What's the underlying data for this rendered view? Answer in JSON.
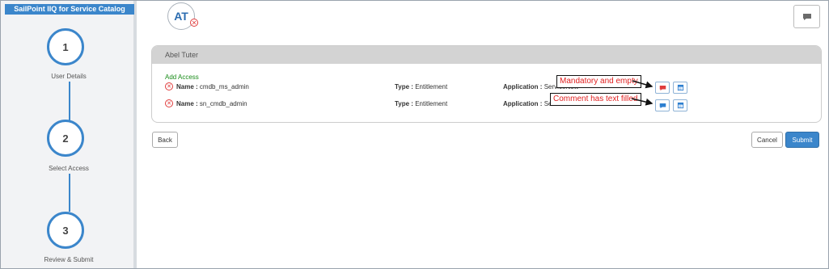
{
  "sidebar": {
    "header": "SailPoint IIQ for Service Catalog",
    "steps": [
      {
        "number": "1",
        "label": "User Details"
      },
      {
        "number": "2",
        "label": "Select Access"
      },
      {
        "number": "3",
        "label": "Review & Submit"
      }
    ]
  },
  "header": {
    "avatar_initials": "AT",
    "avatar_status_icon": "x-circle-icon",
    "comment_icon": "comment-icon"
  },
  "card": {
    "user_name": "Abel Tuter",
    "section_label": "Add Access",
    "rows": [
      {
        "name_label": "Name :",
        "name_value": "cmdb_ms_admin",
        "type_label": "Type :",
        "type_value": "Entitlement",
        "app_label": "Application :",
        "app_value": "ServiceNow"
      },
      {
        "name_label": "Name :",
        "name_value": "sn_cmdb_admin",
        "type_label": "Type :",
        "type_value": "Entitlement",
        "app_label": "Application :",
        "app_value": "ServiceNow"
      }
    ]
  },
  "annotations": {
    "first": "Mandatory and empty",
    "second": "Comment has text filled"
  },
  "buttons": {
    "back": "Back",
    "cancel": "Cancel",
    "submit": "Submit"
  },
  "colors": {
    "accent": "#3b86cb",
    "error": "#e03c3c",
    "success_text": "#1a8c1a",
    "comment_required": "#e03c3c",
    "comment_filled": "#2d7fd0"
  }
}
